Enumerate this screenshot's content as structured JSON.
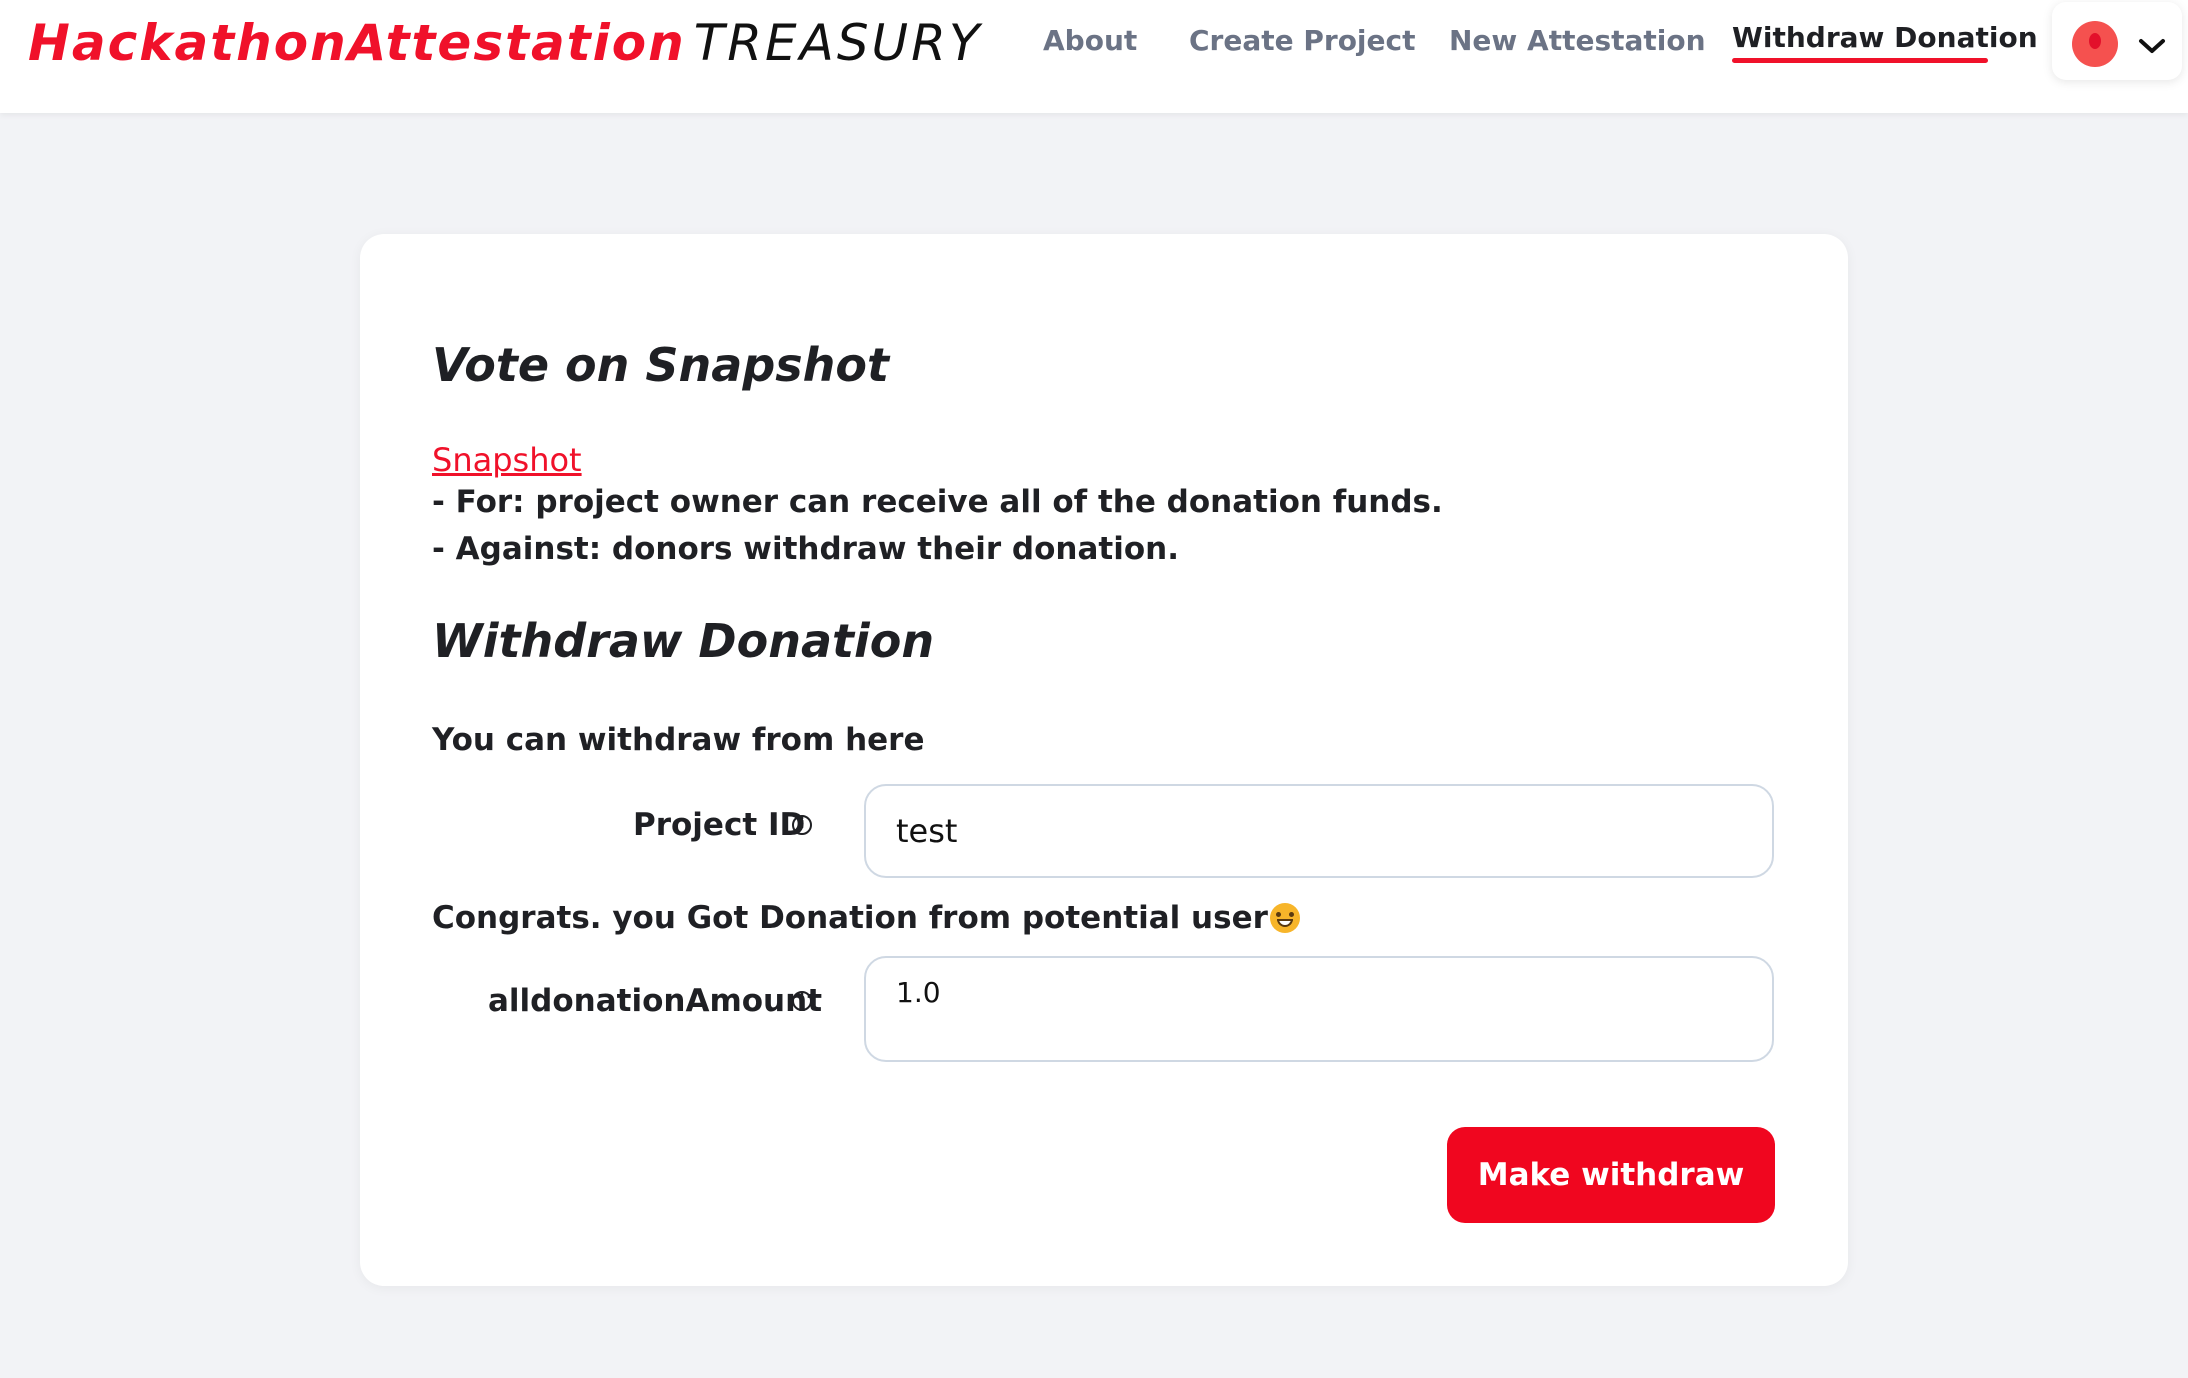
{
  "header": {
    "brand_part1": "HackathonAttestation",
    "brand_part2": "TREASURY",
    "nav": [
      {
        "label": "About"
      },
      {
        "label": "Create Project"
      },
      {
        "label": "New Attestation"
      },
      {
        "label": "Withdraw Donation"
      }
    ],
    "active_nav": "Withdraw Donation",
    "account_icon": "avatar-icon",
    "account_chevron": "chevron-down-icon"
  },
  "vote": {
    "heading": "Vote on Snapshot",
    "link_label": "Snapshot",
    "for_line": "- For: project owner can receive all of the donation funds.",
    "against_line": "- Against: donors withdraw their donation."
  },
  "withdraw": {
    "heading": "Withdraw Donation",
    "intro": "You can withdraw from here",
    "project_id_label": "Project ID",
    "project_id_value": "test",
    "congrats": "Congrats. you Got Donation from potential user",
    "amount_label": "alldonationAmount",
    "amount_value": "1.0",
    "button_label": "Make withdraw"
  },
  "colors": {
    "accent": "#f0112a",
    "background": "#f2f3f6",
    "nav_text": "#6b7385"
  }
}
